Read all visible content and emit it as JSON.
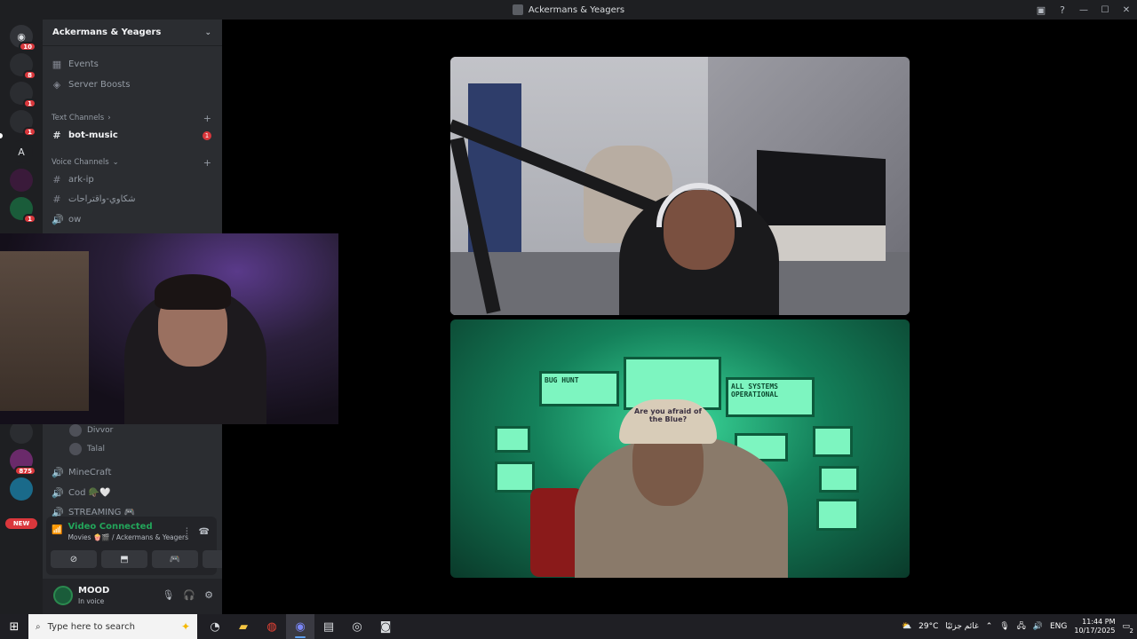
{
  "window": {
    "title": "Ackermans & Yeagers"
  },
  "server_rail": {
    "badges": [
      "10",
      "8",
      "1",
      "1",
      "1",
      "875"
    ],
    "letter_server": "A",
    "new_label": "NEW"
  },
  "sidebar": {
    "server_name": "Ackermans & Yeagers",
    "items": [
      {
        "label": "Events"
      },
      {
        "label": "Server Boosts"
      }
    ],
    "text_category": "Text Channels",
    "text_channels": [
      {
        "label": "bot-music",
        "badge": "1"
      }
    ],
    "voice_category": "Voice Channels",
    "voice_list": [
      {
        "label": "ark-ip"
      },
      {
        "label": "شكاوي-واقتراحات"
      },
      {
        "label": "ow"
      }
    ],
    "members": [
      {
        "name": "Divvor"
      },
      {
        "name": "Talal"
      }
    ],
    "voice_channels_lower": [
      {
        "label": "MineCraft"
      },
      {
        "label": "Cod 🪖🤍"
      },
      {
        "label": "STREAMING 🎮"
      }
    ]
  },
  "voice_panel": {
    "status": "Video Connected",
    "location": "Movies 🍿🎬 / Ackermans & Yeagers"
  },
  "user_panel": {
    "name": "MOOD",
    "status": "In voice"
  },
  "stage": {
    "tile2_screens": {
      "bug_hunt": "BUG HUNT",
      "systems": "ALL SYSTEMS OPERATIONAL",
      "cap_text": "Are you afraid of the Blue?"
    }
  },
  "taskbar": {
    "search_placeholder": "Type here to search",
    "weather": "29°C",
    "weather_desc": "غائم جزئيًا",
    "language": "ENG",
    "time": "11:44 PM",
    "date": "10/17/2025",
    "notification_count": "2"
  },
  "colors": {
    "discord_dark": "#1e1f22",
    "sidebar": "#2b2d31",
    "connected_green": "#23a55a",
    "badge_red": "#da373c"
  }
}
